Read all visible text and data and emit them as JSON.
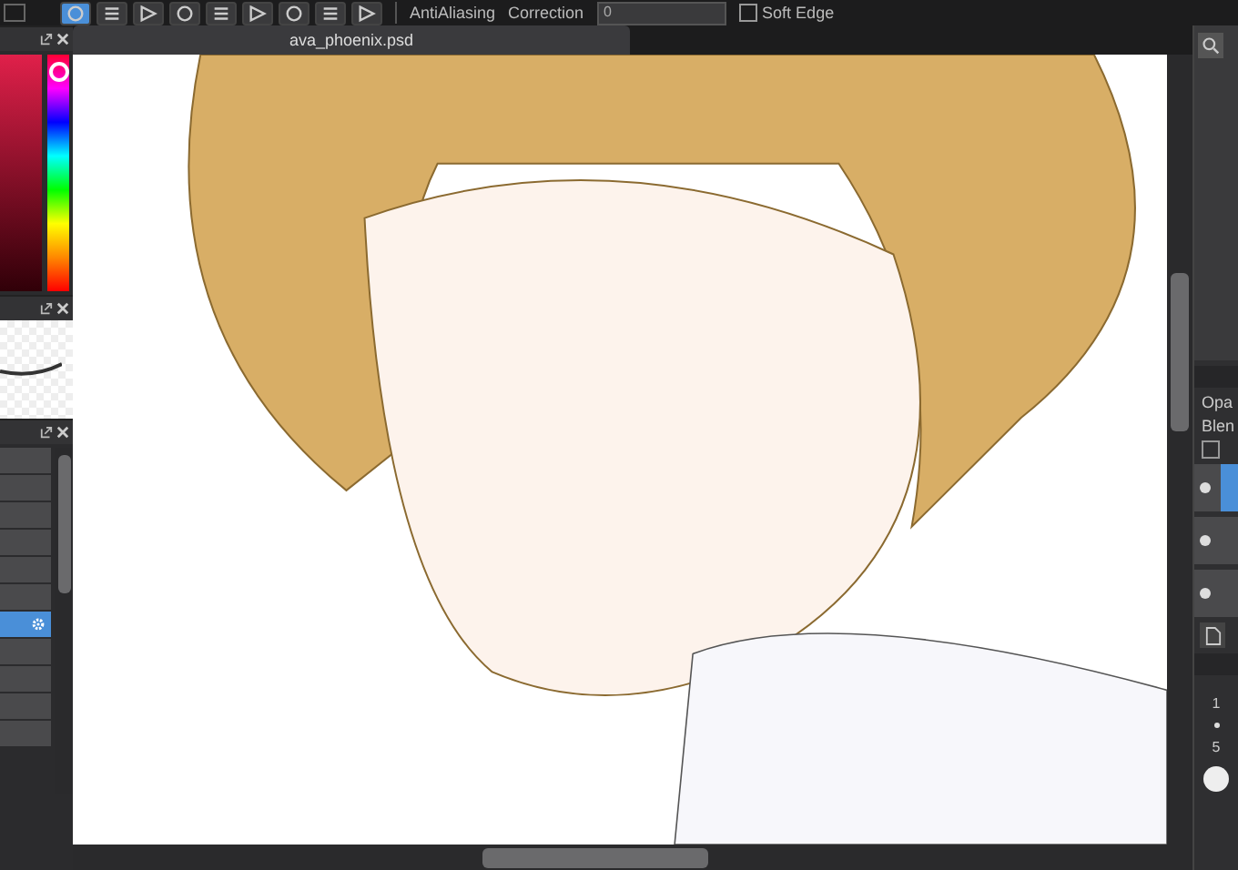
{
  "toolbar": {
    "tools": [
      {
        "selected": true
      },
      {
        "selected": false
      },
      {
        "selected": false
      },
      {
        "selected": false
      },
      {
        "selected": false
      },
      {
        "selected": false
      },
      {
        "selected": false
      },
      {
        "selected": false
      },
      {
        "selected": false
      }
    ],
    "antialiasing_label": "AntiAliasing",
    "correction_label": "Correction",
    "correction_value": "0",
    "soft_edge": {
      "label": "Soft Edge",
      "checked": false
    }
  },
  "document_tab": {
    "title": "ava_phoenix.psd",
    "selected": true
  },
  "left_panel": {
    "hue_slider": {
      "level": 0.03
    },
    "list_rows": [
      {
        "selected": false
      },
      {
        "selected": false
      },
      {
        "selected": false
      },
      {
        "selected": false
      },
      {
        "selected": false
      },
      {
        "selected": false
      },
      {
        "selected": true
      },
      {
        "selected": false
      },
      {
        "selected": false
      },
      {
        "selected": false
      },
      {
        "selected": false
      }
    ]
  },
  "right_panel": {
    "opacity_label": "Opa",
    "blend_label": "Blen",
    "checkbox": {
      "checked": false
    },
    "layers": [
      {
        "selected": true
      },
      {
        "selected": false
      },
      {
        "selected": false
      }
    ],
    "brush_sizes": [
      "1",
      "5"
    ]
  }
}
